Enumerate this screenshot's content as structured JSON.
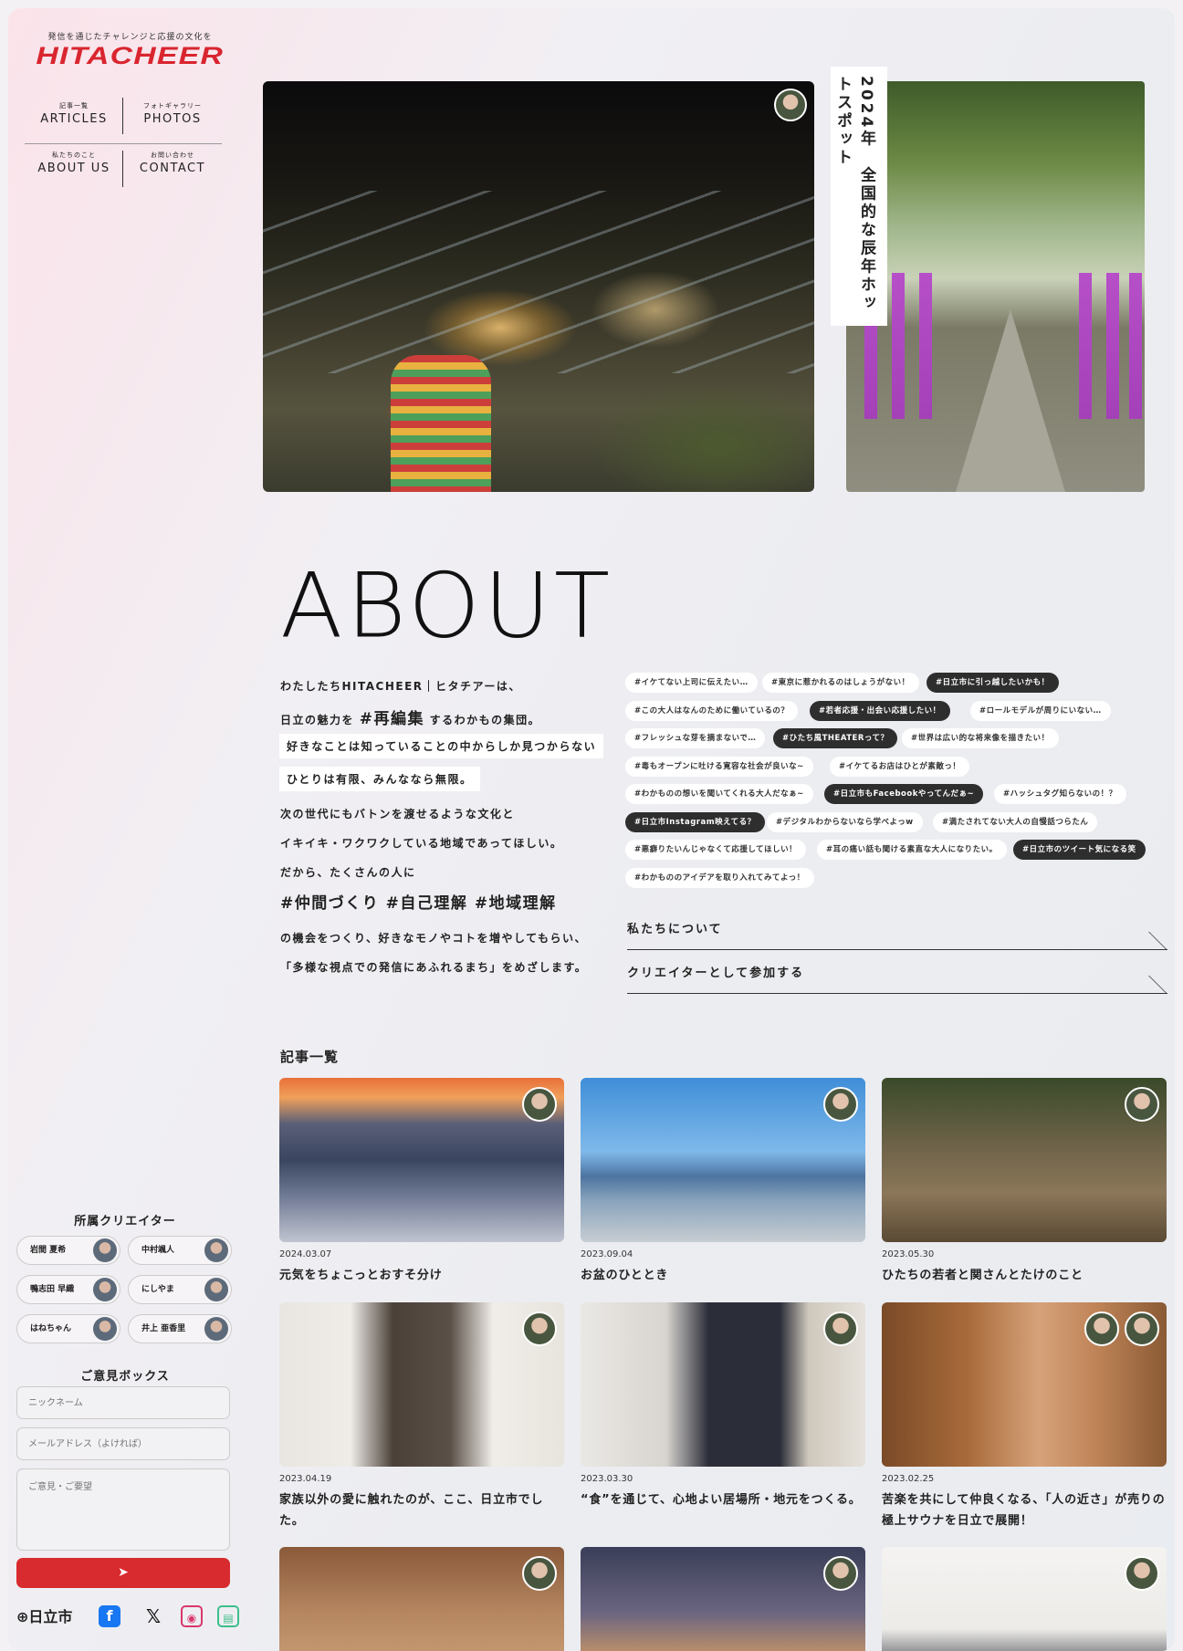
{
  "site": {
    "tagline": "発信を通じたチャレンジと応援の文化を",
    "logo": "HITACHEER"
  },
  "nav": [
    {
      "jp": "記事一覧",
      "en": "ARTICLES"
    },
    {
      "jp": "フォトギャラリー",
      "en": "PHOTOS"
    },
    {
      "jp": "私たちのこと",
      "en": "ABOUT US"
    },
    {
      "jp": "お問い合わせ",
      "en": "CONTACT"
    }
  ],
  "hero": {
    "caption": "2024年　全国的な辰年ホットスポット"
  },
  "about": {
    "heading": "ABOUT",
    "line1": "わたしたちHITACHEER｜ヒタチアーは、",
    "line2a": "日立の魅力を",
    "line2b": "#再編集",
    "line2c": "するわかもの集団。",
    "highlight1": "好きなことは知っていることの中からしか見つからない",
    "highlight2": "ひとりは有限、みんななら無限。",
    "line3": "次の世代にもバトンを渡せるような文化と",
    "line4": "イキイキ・ワクワクしている地域であってほしい。",
    "line5": "だから、たくさんの人に",
    "tags_line": "#仲間づくり #自己理解 #地域理解",
    "line6": "の機会をつくり、好きなモノやコトを増やしてもらい、",
    "line7": "「多様な視点での発信にあふれるまち」をめざします。"
  },
  "hashtags": [
    {
      "text": "#イケてない上司に伝えたい…",
      "dark": false
    },
    {
      "text": "#東京に惹かれるのはしょうがない！",
      "dark": false
    },
    {
      "text": "#日立市に引っ越したいかも！",
      "dark": true
    },
    {
      "text": "#この大人はなんのために働いているの？",
      "dark": false
    },
    {
      "text": "#若者応援・出会い応援したい！",
      "dark": true
    },
    {
      "text": "#ロールモデルが周りにいない…",
      "dark": false
    },
    {
      "text": "#フレッシュな芽を摘まないで…",
      "dark": false
    },
    {
      "text": "#ひたち風THEATERって？",
      "dark": true
    },
    {
      "text": "#世界は広い的な将来像を描きたい！",
      "dark": false
    },
    {
      "text": "#毒もオープンに吐ける寛容な社会が良いな~",
      "dark": false
    },
    {
      "text": "#イケてるお店はひとが素敵っ！",
      "dark": false
    },
    {
      "text": "#わかものの想いを聞いてくれる大人だなぁ~",
      "dark": false
    },
    {
      "text": "#日立市もFacebookやってんだぁ~",
      "dark": true
    },
    {
      "text": "#ハッシュタグ知らないの！？",
      "dark": false
    },
    {
      "text": "#日立市Instagram映えてる？",
      "dark": true
    },
    {
      "text": "#デジタルわからないなら学べよっw",
      "dark": false
    },
    {
      "text": "#満たされてない大人の自慢話つらたん",
      "dark": false
    },
    {
      "text": "#悪癖りたいんじゃなくて応援してほしい！",
      "dark": false
    },
    {
      "text": "#耳の痛い話も聞ける素直な大人になりたい。",
      "dark": false
    },
    {
      "text": "#日立市のツイート気になる笑",
      "dark": true
    },
    {
      "text": "#わかもののアイデアを取り入れてみてよっ！",
      "dark": false
    }
  ],
  "links": [
    {
      "label": "私たちについて"
    },
    {
      "label": "クリエイターとして参加する"
    }
  ],
  "articles_title": "記事一覧",
  "articles": [
    {
      "date": "2024.03.07",
      "title": "元気をちょこっとおすそ分け"
    },
    {
      "date": "2023.09.04",
      "title": "お盆のひととき"
    },
    {
      "date": "2023.05.30",
      "title": "ひたちの若者と関さんとたけのこと"
    },
    {
      "date": "2023.04.19",
      "title": "家族以外の愛に触れたのが、ここ、日立市でした。"
    },
    {
      "date": "2023.03.30",
      "title": "“食”を通じて、心地よい居場所・地元をつくる。"
    },
    {
      "date": "2023.02.25",
      "title": "苦楽を共にして仲良くなる、「人の近さ」が売りの極上サウナを日立で展開！"
    }
  ],
  "creators_title": "所属クリエイター",
  "creators": [
    {
      "name": "岩間 夏希"
    },
    {
      "name": "中村颯人"
    },
    {
      "name": "鴨志田 早織"
    },
    {
      "name": "にしやま"
    },
    {
      "name": "はねちゃん"
    },
    {
      "name": "井上 亜香里"
    }
  ],
  "opinion": {
    "title": "ご意見ボックス",
    "nickname_placeholder": "ニックネーム",
    "email_placeholder": "メールアドレス（よければ）",
    "message_placeholder": "ご意見・ご要望",
    "submit": "➤"
  },
  "footer": {
    "city": "日立市"
  },
  "colors": {
    "accent": "#d82b2f",
    "dark_tag": "#2e2e2e"
  }
}
